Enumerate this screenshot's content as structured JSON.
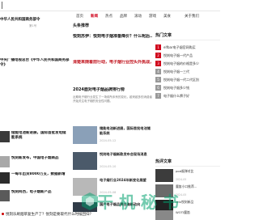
{
  "nav": {
    "items": [
      "首页",
      "新闻",
      "热点",
      "品牌",
      "滚动",
      "游戏",
      "美食",
      "关于我们"
    ],
    "active_index": 1
  },
  "left": {
    "top_title": "中华人民共和国商务部令",
    "top_sub": "第1号",
    "article_title": "中央广播电视总台《中华人民共和国商务部令》",
    "article_meta": "",
    "rows": [
      {
        "title": "储能电池新进展，国际首批发电储能系统"
      },
      {
        "title": "悦刻新发布，中国电子烟商品"
      },
      {
        "title": "一每年出货8000万支，数据新增"
      },
      {
        "title": "悦刻阿西，电子烟新产品"
      }
    ]
  },
  "mid": {
    "header": "头条推荐",
    "headlines": [
      {
        "title": "悦刻苏伊：悦刻电子烟准备降价？什么呢后..."
      },
      {
        "title": "清楚来随着前行动，电子烟行业控头外挑战，..."
      },
      {
        "title": "2024面对电子烟品牌排行榜"
      }
    ],
    "snippet": "近期电子烟行业发生了一场前所未有的变化，越来越多的消费者开始关注电子烟的安全性问题。",
    "rows": [
      {
        "title": "储能电池新进展，国际首批电池储能系统",
        "meta": "2024-05-12"
      },
      {
        "title": "悦刻电子烟新款发布会现场消息",
        "meta": "2024-05-10"
      },
      {
        "title": "电子烟行业2024年新变化展望",
        "meta": "2024-05-08"
      },
      {
        "title": "国产电子烟品牌出海新动向",
        "meta": "2024-05-06"
      }
    ]
  },
  "right": {
    "hot_header": "热门文章",
    "hot_items": [
      {
        "num": "1",
        "label": "elfbar电子烟官网购买"
      },
      {
        "num": "2",
        "label": "悦刻电子烟一代产品"
      },
      {
        "num": "3",
        "label": "悦刻电子烟的价格是多少"
      },
      {
        "num": "4",
        "label": "悦刻电子烟一三代"
      },
      {
        "num": "5",
        "label": "悦刻电子烟一代二代区别"
      },
      {
        "num": "6",
        "label": "悦刻电子烟多少钱"
      },
      {
        "num": "7",
        "label": "电子烟什么牌子好"
      }
    ],
    "rec_header": "热评文章",
    "rec_items": [
      {
        "title": "pod烟弹对比",
        "date": "2024-05"
      },
      {
        "title": "魔笛小口推荐...",
        "date": "2024-05"
      },
      {
        "title": "relx悦刻新品",
        "date": "2024-04"
      },
      {
        "title": "WOTI魔笛",
        "date": "2024-04"
      }
    ]
  },
  "watermark": {
    "text": "干  机  秘  书"
  },
  "bottom": {
    "link": "悦刻乐刷烟草复生产了？悦刻是要取代什么时候回归？"
  },
  "colors": {
    "accent": "#d0021b",
    "watermark": "#00a06e"
  }
}
